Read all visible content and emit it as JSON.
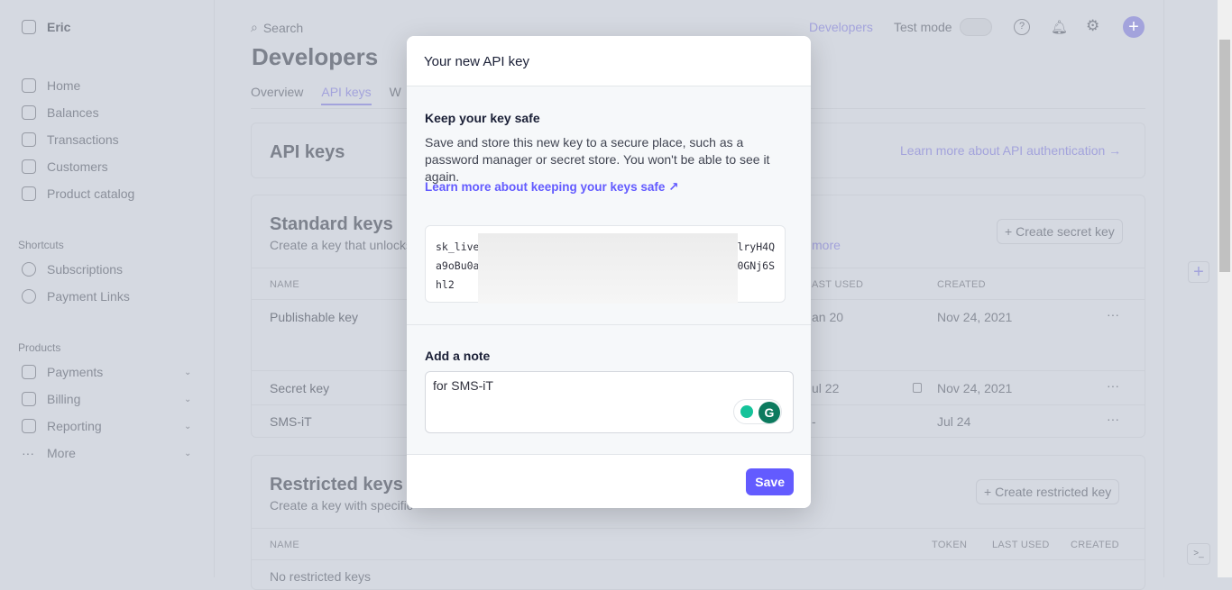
{
  "account": {
    "name": "Eric"
  },
  "sidebar": {
    "items": [
      {
        "label": "Home"
      },
      {
        "label": "Balances"
      },
      {
        "label": "Transactions"
      },
      {
        "label": "Customers"
      },
      {
        "label": "Product catalog"
      }
    ],
    "shortcuts_title": "Shortcuts",
    "shortcuts": [
      {
        "label": "Subscriptions"
      },
      {
        "label": "Payment Links"
      }
    ],
    "products_title": "Products",
    "products": [
      {
        "label": "Payments"
      },
      {
        "label": "Billing"
      },
      {
        "label": "Reporting"
      },
      {
        "label": "More"
      }
    ]
  },
  "topbar": {
    "search_placeholder": "Search",
    "developers": "Developers",
    "test_mode": "Test mode"
  },
  "page": {
    "title": "Developers",
    "tabs": [
      {
        "label": "Overview"
      },
      {
        "label": "API keys"
      },
      {
        "label": "W"
      }
    ],
    "api_keys_title": "API keys",
    "api_auth_link": "Learn more about API authentication →",
    "standard": {
      "title": "Standard keys",
      "subtitle": "Create a key that unlocks",
      "more_link": "more",
      "create_button": "Create secret key",
      "headers": {
        "name": "NAME",
        "last_used": "AST USED",
        "created": "CREATED"
      },
      "rows": [
        {
          "name": "Publishable key",
          "last_used": "an 20",
          "created": "Nov 24, 2021"
        },
        {
          "name": "Secret key",
          "last_used": "ul 22",
          "created": "Nov 24, 2021"
        },
        {
          "name": "SMS-iT",
          "last_used": "-",
          "created": "Jul 24"
        }
      ]
    },
    "restricted": {
      "title": "Restricted keys",
      "subtitle": "Create a key with specific",
      "create_button": "Create restricted key",
      "headers": {
        "name": "NAME",
        "token": "TOKEN",
        "last_used": "LAST USED",
        "created": "CREATED"
      },
      "empty": "No restricted keys"
    }
  },
  "modal": {
    "title": "Your new API key",
    "keep_title": "Keep your key safe",
    "keep_text": "Save and store this new key to a secure place, such as a password manager or secret store. You won't be able to see it again.",
    "keep_link": "Learn more about keeping your keys safe",
    "key_lines": [
      {
        "start": "sk_live",
        "end": "lryH4Q"
      },
      {
        "start": "a9oBu0a",
        "end": "0GNj6S"
      },
      {
        "start": "hl2",
        "end": ""
      }
    ],
    "note_label": "Add a note",
    "note_value": "for SMS-iT",
    "save": "Save"
  },
  "colors": {
    "accent": "#635bff",
    "overlay_bg": "#d5d9e1"
  }
}
